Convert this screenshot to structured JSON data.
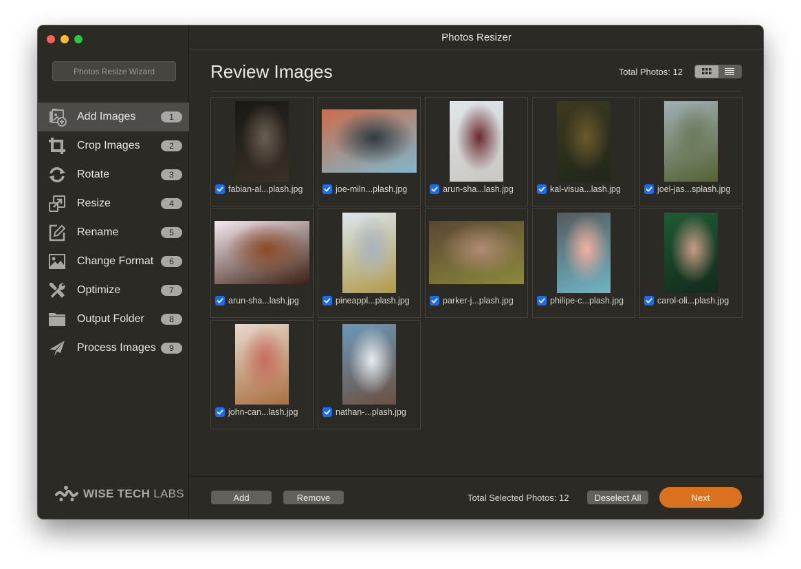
{
  "window": {
    "title": "Photos Resizer",
    "controls": [
      "close",
      "minimize",
      "maximize"
    ]
  },
  "sidebar": {
    "wizard_button": "Photos Resize Wizard",
    "active_index": 0,
    "items": [
      {
        "label": "Add Images",
        "badge": "1",
        "icon": "add-images-icon"
      },
      {
        "label": "Crop Images",
        "badge": "2",
        "icon": "crop-icon"
      },
      {
        "label": "Rotate",
        "badge": "3",
        "icon": "rotate-icon"
      },
      {
        "label": "Resize",
        "badge": "4",
        "icon": "resize-icon"
      },
      {
        "label": "Rename",
        "badge": "5",
        "icon": "rename-icon"
      },
      {
        "label": "Change Format",
        "badge": "6",
        "icon": "image-format-icon"
      },
      {
        "label": "Optimize",
        "badge": "7",
        "icon": "tools-icon"
      },
      {
        "label": "Output Folder",
        "badge": "8",
        "icon": "folder-icon"
      },
      {
        "label": "Process Images",
        "badge": "9",
        "icon": "paper-plane-icon"
      }
    ],
    "brand": {
      "bold": "WISE TECH",
      "light": "LABS"
    }
  },
  "main": {
    "title": "Review Images",
    "total_photos": "Total Photos: 12",
    "view_modes": {
      "active": "grid",
      "options": [
        "grid",
        "list"
      ]
    },
    "images": [
      {
        "name": "fabian-al...plash.jpg",
        "checked": true,
        "orientation": "portrait",
        "colors": [
          "#1a1714",
          "#6b5f52",
          "#3a3128"
        ]
      },
      {
        "name": "joe-miln...plash.jpg",
        "checked": true,
        "orientation": "landscape",
        "colors": [
          "#c96e4b",
          "#2d3b44",
          "#7fb7cc"
        ]
      },
      {
        "name": "arun-sha...lash.jpg",
        "checked": true,
        "orientation": "portrait",
        "colors": [
          "#dfe6ea",
          "#6a2a32",
          "#c9c7c2"
        ]
      },
      {
        "name": "kal-visua...lash.jpg",
        "checked": true,
        "orientation": "portrait",
        "colors": [
          "#3d3a1f",
          "#6b5a2d",
          "#20261a"
        ]
      },
      {
        "name": "joel-jas...splash.jpg",
        "checked": true,
        "orientation": "portrait",
        "colors": [
          "#9fb0b4",
          "#6b7a5a",
          "#556134"
        ]
      },
      {
        "name": "arun-sha...lash.jpg",
        "checked": true,
        "orientation": "landscape",
        "colors": [
          "#f6e9f1",
          "#8a4a25",
          "#3b2014"
        ]
      },
      {
        "name": "pineappl...plash.jpg",
        "checked": true,
        "orientation": "portrait",
        "colors": [
          "#dce6ee",
          "#a7b4be",
          "#b09a4a"
        ]
      },
      {
        "name": "parker-j...plash.jpg",
        "checked": true,
        "orientation": "landscape",
        "colors": [
          "#5a4634",
          "#b08a76",
          "#8b8a3a"
        ]
      },
      {
        "name": "philipe-c...plash.jpg",
        "checked": true,
        "orientation": "portrait",
        "colors": [
          "#545a5c",
          "#f3b09f",
          "#6fb5c6"
        ]
      },
      {
        "name": "carol-oli...plash.jpg",
        "checked": true,
        "orientation": "portrait",
        "colors": [
          "#1f5a34",
          "#c99c86",
          "#122a1c"
        ]
      },
      {
        "name": "john-can...lash.jpg",
        "checked": true,
        "orientation": "portrait",
        "colors": [
          "#e8d9cd",
          "#c76b5e",
          "#a86f3f"
        ]
      },
      {
        "name": "nathan-...plash.jpg",
        "checked": true,
        "orientation": "portrait",
        "colors": [
          "#6c98b8",
          "#e8ecef",
          "#6b5040"
        ]
      }
    ]
  },
  "footer": {
    "add_label": "Add",
    "remove_label": "Remove",
    "selected_count": "Total Selected Photos: 12",
    "deselect_label": "Deselect All",
    "next_label": "Next"
  },
  "colors": {
    "accent": "#d9711e",
    "checkbox": "#1a6df0",
    "background": "#2b2a25"
  }
}
